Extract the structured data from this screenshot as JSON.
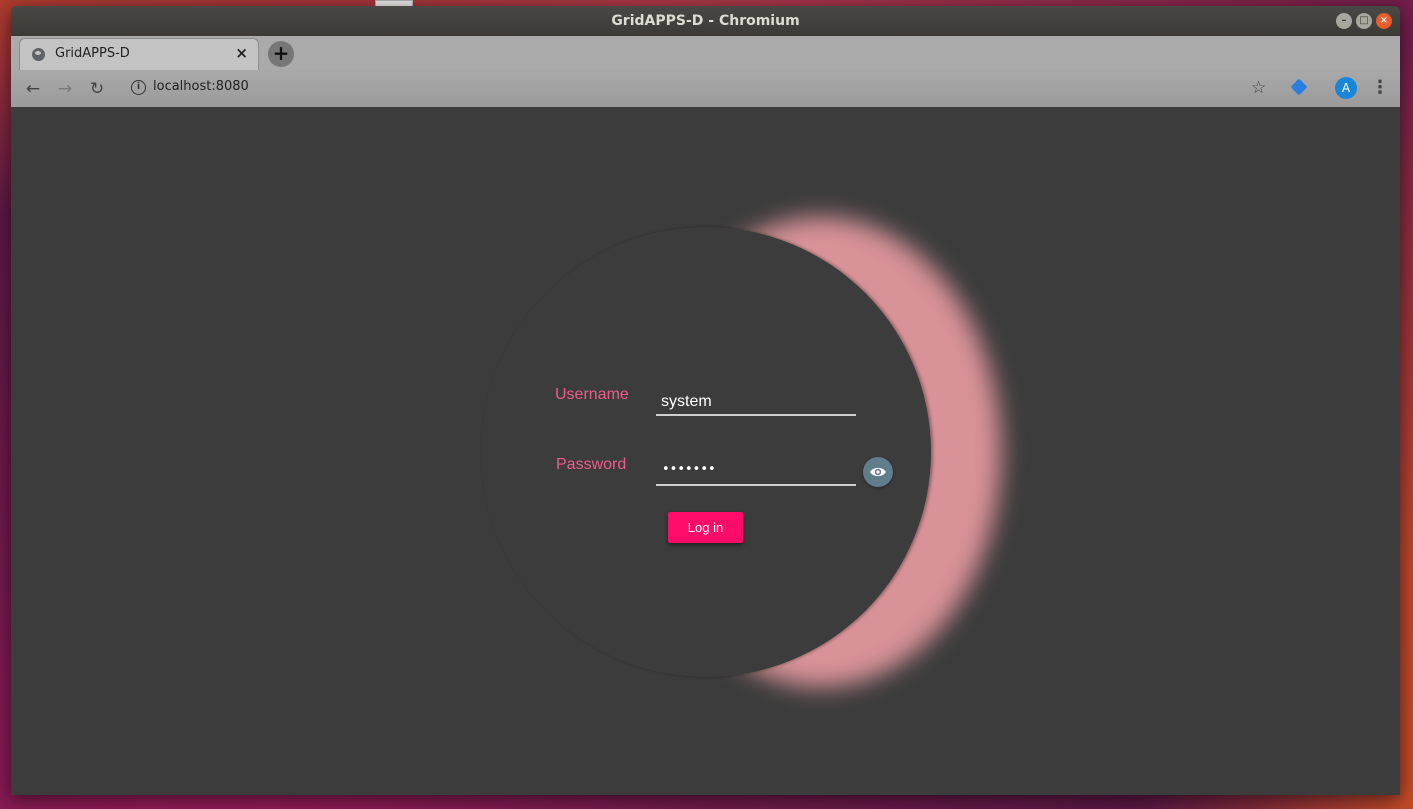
{
  "window": {
    "title": "GridAPPS-D - Chromium"
  },
  "tabs": [
    {
      "label": "GridAPPS-D",
      "close": "×"
    }
  ],
  "new_tab_label": "+",
  "address_bar": {
    "url": "localhost:8080"
  },
  "profile": {
    "initial": "A"
  },
  "login_form": {
    "username_label": "Username",
    "username_value": "system",
    "password_label": "Password",
    "password_masked": "•••••••",
    "login_button_label": "Log in"
  },
  "colors": {
    "label": "#ec5d8a",
    "button": "#ff0b6a",
    "eye_button": "#607d8b",
    "glow": "#d89298",
    "background": "#3c3c3c"
  }
}
